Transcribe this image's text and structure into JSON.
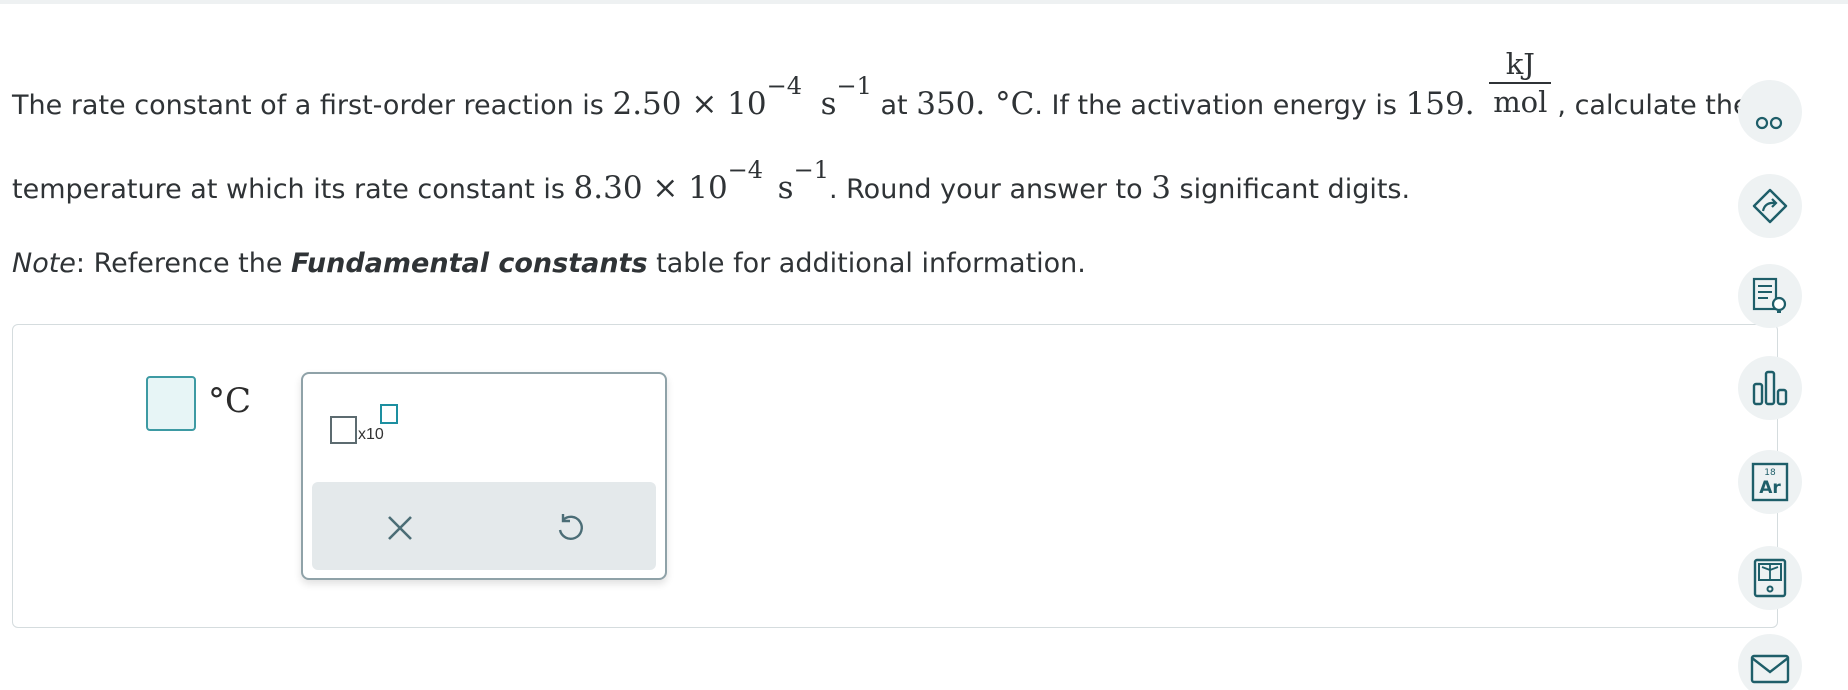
{
  "question": {
    "line1_part1": "The rate constant of a first-order reaction is ",
    "line1_value": "2.50 × 10",
    "line1_exp": "−4",
    "line1_unit": "s",
    "line1_unit_exp": "−1",
    "line1_part2": " at ",
    "line1_temp": "350. °C",
    "line1_part3": ". If the activation energy is ",
    "line1_energy": "159.",
    "frac_num": "kJ",
    "frac_den": "mol",
    "line1_part4": ", calculate the",
    "line2_part1": "temperature at which its rate constant is ",
    "line2_value": "8.30 × 10",
    "line2_exp": "−4",
    "line2_unit": "s",
    "line2_unit_exp": "−1",
    "line2_part2": ". Round your answer to ",
    "line2_digits": "3",
    "line2_part3": " significant digits.",
    "note_label": "Note",
    "note_text1": ": Reference the ",
    "note_bold": "Fundamental constants",
    "note_text2": " table for additional information."
  },
  "answer": {
    "unit": "°C",
    "value": ""
  },
  "palette": {
    "sci_label": "x10"
  },
  "colors": {
    "accent": "#1d8fa0",
    "side_icon": "#1e5e69",
    "side_bg": "#eef2f3"
  },
  "sidebar_icons": [
    "open-eye-icon",
    "eraser-sign-icon",
    "lightbulb-notes-icon",
    "bar-chart-icon",
    "periodic-table-icon",
    "calculator-book-icon",
    "mail-icon"
  ]
}
